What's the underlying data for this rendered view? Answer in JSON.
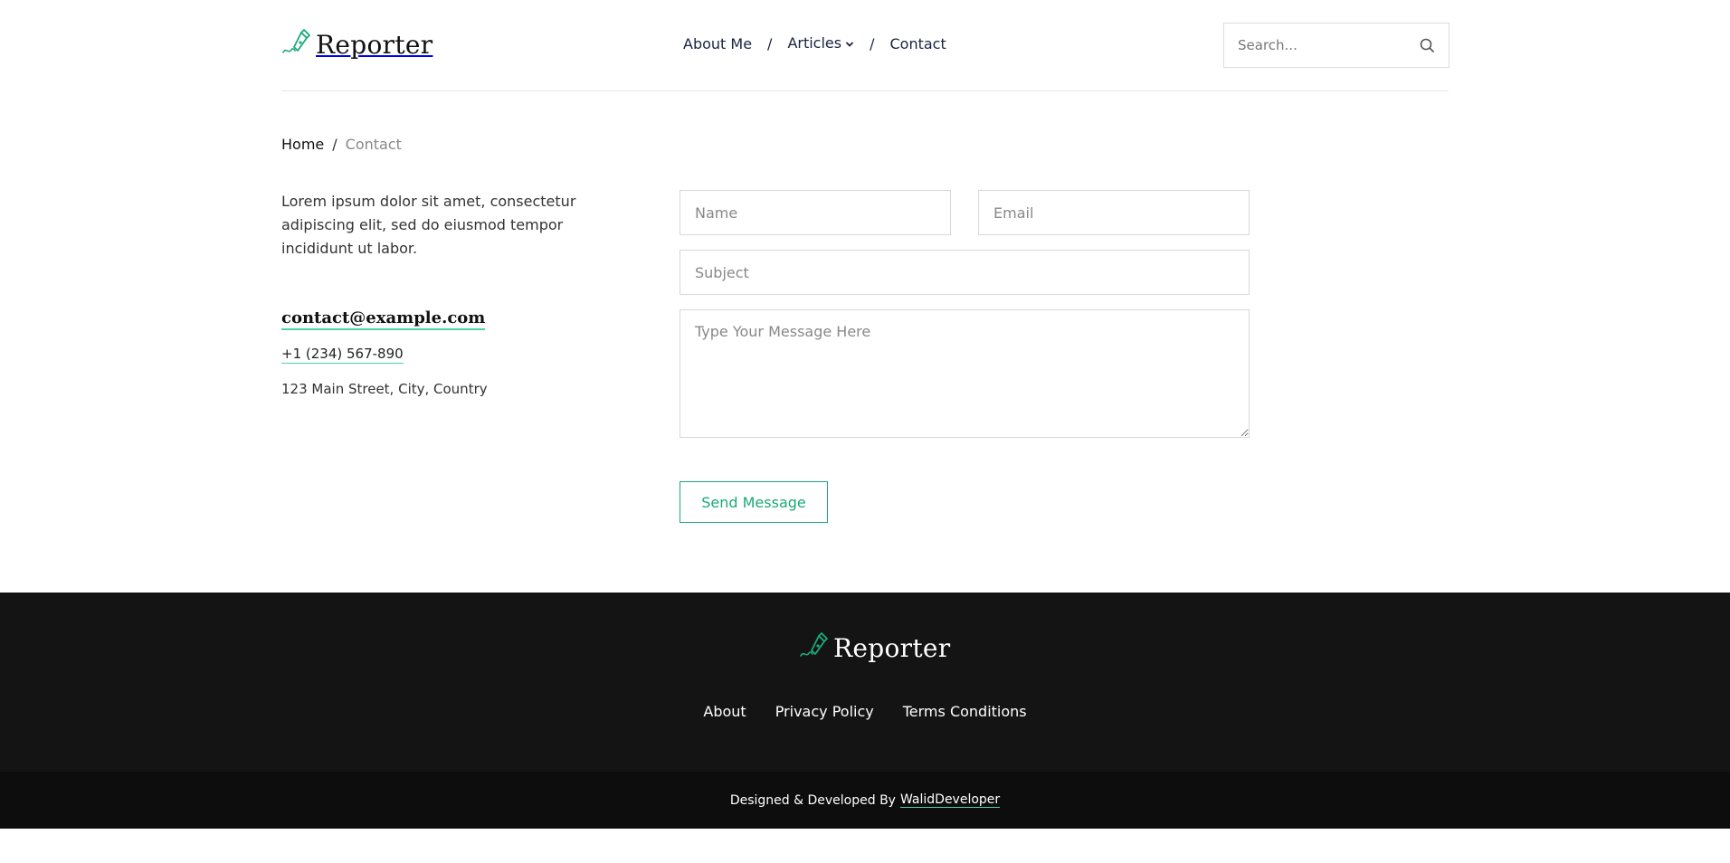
{
  "header": {
    "logo_text": "Reporter",
    "nav": {
      "about": "About Me",
      "articles": "Articles",
      "contact": "Contact",
      "separator": "/"
    },
    "search_placeholder": "Search..."
  },
  "breadcrumb": {
    "home": "Home",
    "separator": "/",
    "current": "Contact"
  },
  "info": {
    "intro": "Lorem ipsum dolor sit amet, consectetur adipiscing elit, sed do eiusmod tempor incididunt ut labor.",
    "email": "contact@example.com",
    "phone": "+1 (234) 567-890",
    "address": "123 Main Street, City, Country"
  },
  "form": {
    "name_placeholder": "Name",
    "email_placeholder": "Email",
    "subject_placeholder": "Subject",
    "message_placeholder": "Type Your Message Here",
    "submit_label": "Send Message"
  },
  "footer": {
    "logo_text": "Reporter",
    "links": [
      "About",
      "Privacy Policy",
      "Terms Conditions"
    ],
    "credit_prefix": "Designed & Developed By",
    "credit_link": "WalidDeveloper"
  },
  "colors": {
    "accent": "#1aaa76",
    "accent_light": "#4fd1a6",
    "nav_text": "#1a2340",
    "footer_bg": "#141414",
    "copyright_bg": "#0d0d0d"
  },
  "icons": {
    "logo": "pen-nib-icon",
    "articles_dropdown": "chevron-down-icon",
    "search": "search-icon"
  }
}
